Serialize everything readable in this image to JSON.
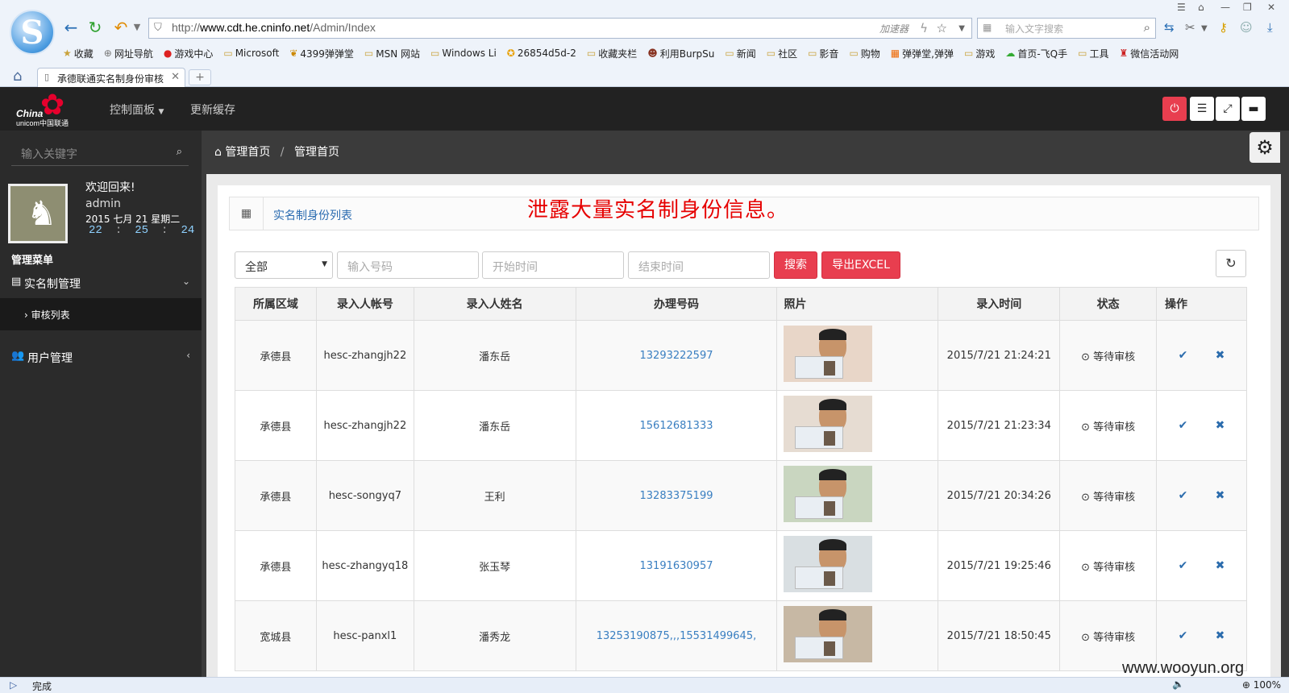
{
  "browser": {
    "url_prefix": "http://",
    "url_host": "www.cdt.he.cninfo.net",
    "url_path": "/Admin/Index",
    "accelerator": "加速器",
    "search_placeholder": "输入文字搜索",
    "tab_title": "承德联通实名制身份审核",
    "bookmarks": [
      "收藏",
      "网址导航",
      "游戏中心",
      "Microsoft",
      "4399弹弹堂",
      "MSN 网站",
      "Windows Li",
      "26854d5d-2",
      "收藏夹栏",
      "利用BurpSu",
      "新闻",
      "社区",
      "影音",
      "购物",
      "弹弹堂,弹弹",
      "游戏",
      "首页-飞Q手",
      "工具",
      "微信活动网"
    ],
    "status_text": "完成",
    "zoom": "100%"
  },
  "app": {
    "logo_text1": "China",
    "logo_text2": "unicom中国联通",
    "menu_control": "控制面板",
    "menu_cache": "更新缓存"
  },
  "sidebar": {
    "search_placeholder": "输入关键字",
    "welcome": "欢迎回来!",
    "username": "admin",
    "date": "2015 七月 21 星期二",
    "clock": {
      "h": "22",
      "m": "25",
      "s": "24"
    },
    "menu_head": "管理菜单",
    "item_realname": "实名制管理",
    "sub_review": "审核列表",
    "item_users": "用户管理"
  },
  "content": {
    "breadcrumb_home": "管理首页",
    "breadcrumb_sep": "/",
    "breadcrumb_current": "管理首页",
    "panel_title": "实名制身份列表",
    "leak_note": "泄露大量实名制身份信息。",
    "filter_select": "全部",
    "number_placeholder": "输入号码",
    "start_placeholder": "开始时间",
    "end_placeholder": "结束时间",
    "search_btn": "搜索",
    "export_btn": "导出EXCEL"
  },
  "table": {
    "headers": [
      "所属区域",
      "录入人帐号",
      "录入人姓名",
      "办理号码",
      "照片",
      "录入时间",
      "状态",
      "操作"
    ],
    "rows": [
      {
        "area": "承德县",
        "account": "hesc-zhangjh22",
        "name": "潘东岳",
        "phone": "13293222597",
        "time": "2015/7/21 21:24:21",
        "status": "等待审核"
      },
      {
        "area": "承德县",
        "account": "hesc-zhangjh22",
        "name": "潘东岳",
        "phone": "15612681333",
        "time": "2015/7/21 21:23:34",
        "status": "等待审核"
      },
      {
        "area": "承德县",
        "account": "hesc-songyq7",
        "name": "王利",
        "phone": "13283375199",
        "time": "2015/7/21 20:34:26",
        "status": "等待审核"
      },
      {
        "area": "承德县",
        "account": "hesc-zhangyq18",
        "name": "张玉琴",
        "phone": "13191630957",
        "time": "2015/7/21 19:25:46",
        "status": "等待审核"
      },
      {
        "area": "宽城县",
        "account": "hesc-panxl1",
        "name": "潘秀龙",
        "phone": "13253190875,,,15531499645,",
        "time": "2015/7/21 18:50:45",
        "status": "等待审核"
      }
    ]
  },
  "watermark": "www.wooyun.org",
  "colors": {
    "accent_red": "#e83e4f",
    "link_blue": "#3a7fc1",
    "status_red": "#ee0000"
  }
}
